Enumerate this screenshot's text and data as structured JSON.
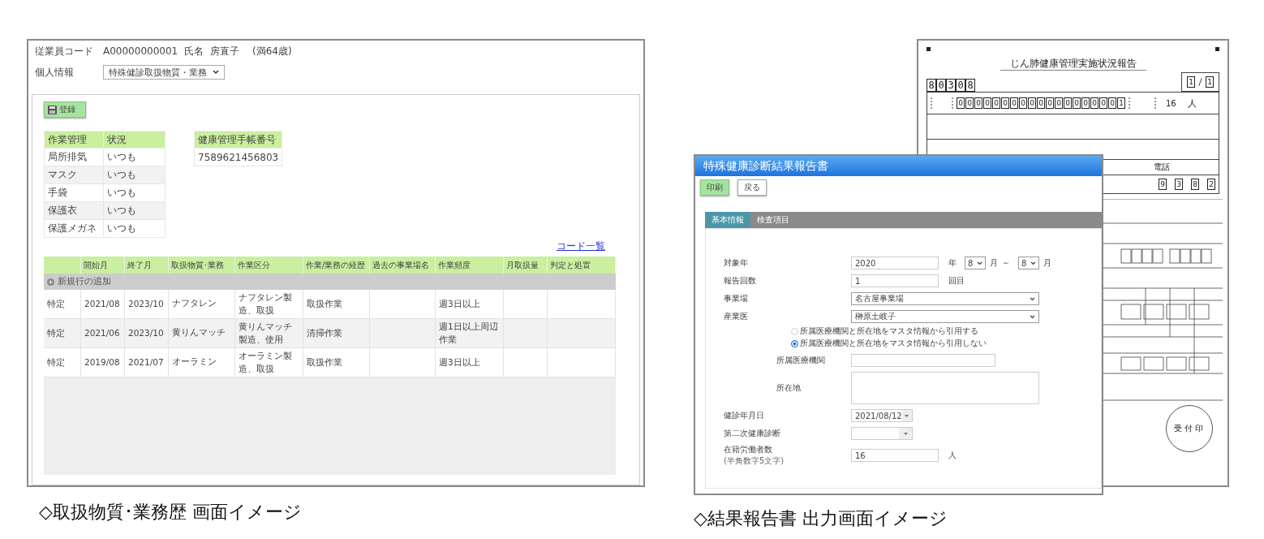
{
  "history_screen": {
    "employee_code_label": "従業員コード",
    "employee_code": "A00000000001",
    "name_label": "氏名",
    "name": "房直子",
    "age": "(満64歳)",
    "personal_info_label": "個人情報",
    "personal_info_select": "特殊健診取扱物質・業務",
    "register_button": "登録",
    "work_management": {
      "columns": [
        "作業管理",
        "状況"
      ],
      "rows": [
        {
          "item": "局所排気",
          "status": "いつも"
        },
        {
          "item": "マスク",
          "status": "いつも"
        },
        {
          "item": "手袋",
          "status": "いつも"
        },
        {
          "item": "保護衣",
          "status": "いつも"
        },
        {
          "item": "保護メガネ",
          "status": "いつも"
        }
      ]
    },
    "health_book": {
      "column": "健康管理手帳番号",
      "value": "7589621456803"
    },
    "code_list_link": "コード一覧",
    "history_table": {
      "columns": [
        "",
        "開始月",
        "終了月",
        "取扱物質･業務",
        "作業区分",
        "作業/業務の経歴",
        "過去の事業場名",
        "作業頻度",
        "月取扱量",
        "判定と処置"
      ],
      "add_row": "新規行の追加",
      "rows": [
        [
          "特定",
          "2021/08",
          "2023/10",
          "ナフタレン",
          "ナフタレン製造、取扱",
          "取扱作業",
          "",
          "週3日以上",
          "",
          ""
        ],
        [
          "特定",
          "2021/06",
          "2023/10",
          "黄りんマッチ",
          "黄りんマッチ製造、使用",
          "清掃作業",
          "",
          "週1日以上周辺作業",
          "",
          ""
        ],
        [
          "特定",
          "2019/08",
          "2021/07",
          "オーラミン",
          "オーラミン製造、取扱",
          "取扱作業",
          "",
          "週3日以上",
          "",
          ""
        ]
      ]
    },
    "caption": "◇取扱物質･業務歴  画面イメージ"
  },
  "report_screen": {
    "document": {
      "title": "じん肺健康管理実施状況報告",
      "code_digits": [
        "8",
        "0",
        "3",
        "0",
        "8"
      ],
      "page": "1",
      "total_pages": "1",
      "insurance_digits": [
        "0",
        "0",
        "0",
        "0",
        "0",
        "0",
        "0",
        "0",
        "0",
        "0",
        "0",
        "0",
        "0",
        "0",
        "0",
        "0",
        "0",
        "0",
        "1"
      ],
      "workers": "16",
      "workers_unit": "人",
      "phone_label": "電話",
      "date_digits": [
        "9",
        "3",
        "8",
        "2"
      ],
      "stamp": "受付印"
    },
    "dialog": {
      "title": "特殊健康診断結果報告書",
      "buttons": [
        {
          "label": "印刷",
          "primary": true
        },
        {
          "label": "戻る",
          "primary": false
        }
      ],
      "tabs": [
        {
          "label": "基本情報",
          "selected": true
        },
        {
          "label": "検査項目",
          "selected": false
        }
      ],
      "target_year": {
        "label": "対象年",
        "value": "2020",
        "unit": "年",
        "month_from": "8",
        "month_unit": "月",
        "tilde": "～",
        "month_to": "8",
        "month_unit_2": "月"
      },
      "report_count": {
        "label": "報告回数",
        "value": "1",
        "unit": "回目"
      },
      "workplace": {
        "label": "事業場",
        "value": "名古屋事業場"
      },
      "doctor": {
        "label": "産業医",
        "value": "榊原土岐子"
      },
      "radios": [
        {
          "label": "所属医療機関と所在地をマスタ情報から引用する",
          "selected": false
        },
        {
          "label": "所属医療機関と所在地をマスタ情報から引用しない",
          "selected": true
        }
      ],
      "institution": {
        "label": "所属医療機関"
      },
      "address": {
        "label": "所在地"
      },
      "exam_date": {
        "label": "健診年月日",
        "value": "2021/08/12"
      },
      "second_exam": {
        "label": "第二次健康診断"
      },
      "worker_count": {
        "label": "在籍労働者数",
        "note": "(半角数字5文字)",
        "value": "16",
        "unit": "人"
      }
    },
    "caption": "◇結果報告書 出力画面イメージ"
  }
}
